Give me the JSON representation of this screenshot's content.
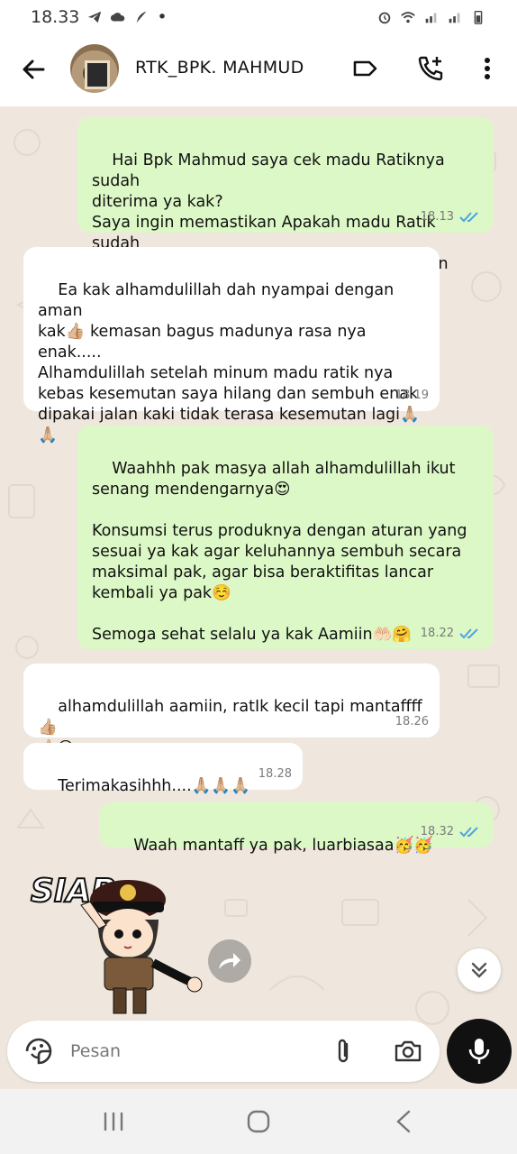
{
  "status_bar": {
    "time": "18.33",
    "dot": "•"
  },
  "header": {
    "contact_name": "RTK_BPK. MAHMUD"
  },
  "messages": [
    {
      "id": "m1",
      "direction": "out",
      "text": "Hai Bpk Mahmud saya cek madu Ratiknya sudah\nditerima ya kak?\nSaya ingin memastikan Apakah madu Ratik sudah\nditerima dengan aman? Tidak ada kerusakan\nkemasan bocor atau hal lainnya kak?",
      "time": "18.13"
    },
    {
      "id": "m2",
      "direction": "in",
      "text": "Ea kak alhamdulillah dah nyampai dengan aman\nkak👍🏼 kemasan bagus madunya rasa nya enak.....\nAlhamdulillah setelah minum madu ratik nya\nkebas kesemutan saya hilang dan sembuh enak\ndipakai jalan kaki tidak terasa kesemutan lagi🙏🏼\n🙏🏼",
      "time": "18.19"
    },
    {
      "id": "m3",
      "direction": "out",
      "text": "Waahhh pak masya allah alhamdulillah ikut\nsenang mendengarnya😍\n\nKonsumsi terus produknya dengan aturan yang\nsesuai ya kak agar keluhannya sembuh secara\nmaksimal pak, agar bisa beraktifitas lancar\nkembali ya pak☺️\n\nSemoga sehat selalu ya kak Aamiin🤲🏻🤗",
      "time": "18.22"
    },
    {
      "id": "m4",
      "direction": "in",
      "text": "alhamdulillah aamiin, ratIk kecil tapi mantaffff👍🏼\n👍🏼😅",
      "time": "18.26"
    },
    {
      "id": "m5",
      "direction": "in",
      "text": "Terimakasihhh....🙏🏼🙏🏼🙏🏼",
      "time": "18.28"
    },
    {
      "id": "m6",
      "direction": "out",
      "text": "Waah mantaff ya pak, luarbiasaa🥳🥳",
      "time": "18.32"
    }
  ],
  "sticker": {
    "text": "SIAP"
  },
  "composer": {
    "placeholder": "Pesan"
  },
  "colors": {
    "outgoing": "#dcf8c6",
    "incoming": "#ffffff",
    "read_ticks": "#4fa3e0",
    "chat_bg": "#efe7dd"
  }
}
